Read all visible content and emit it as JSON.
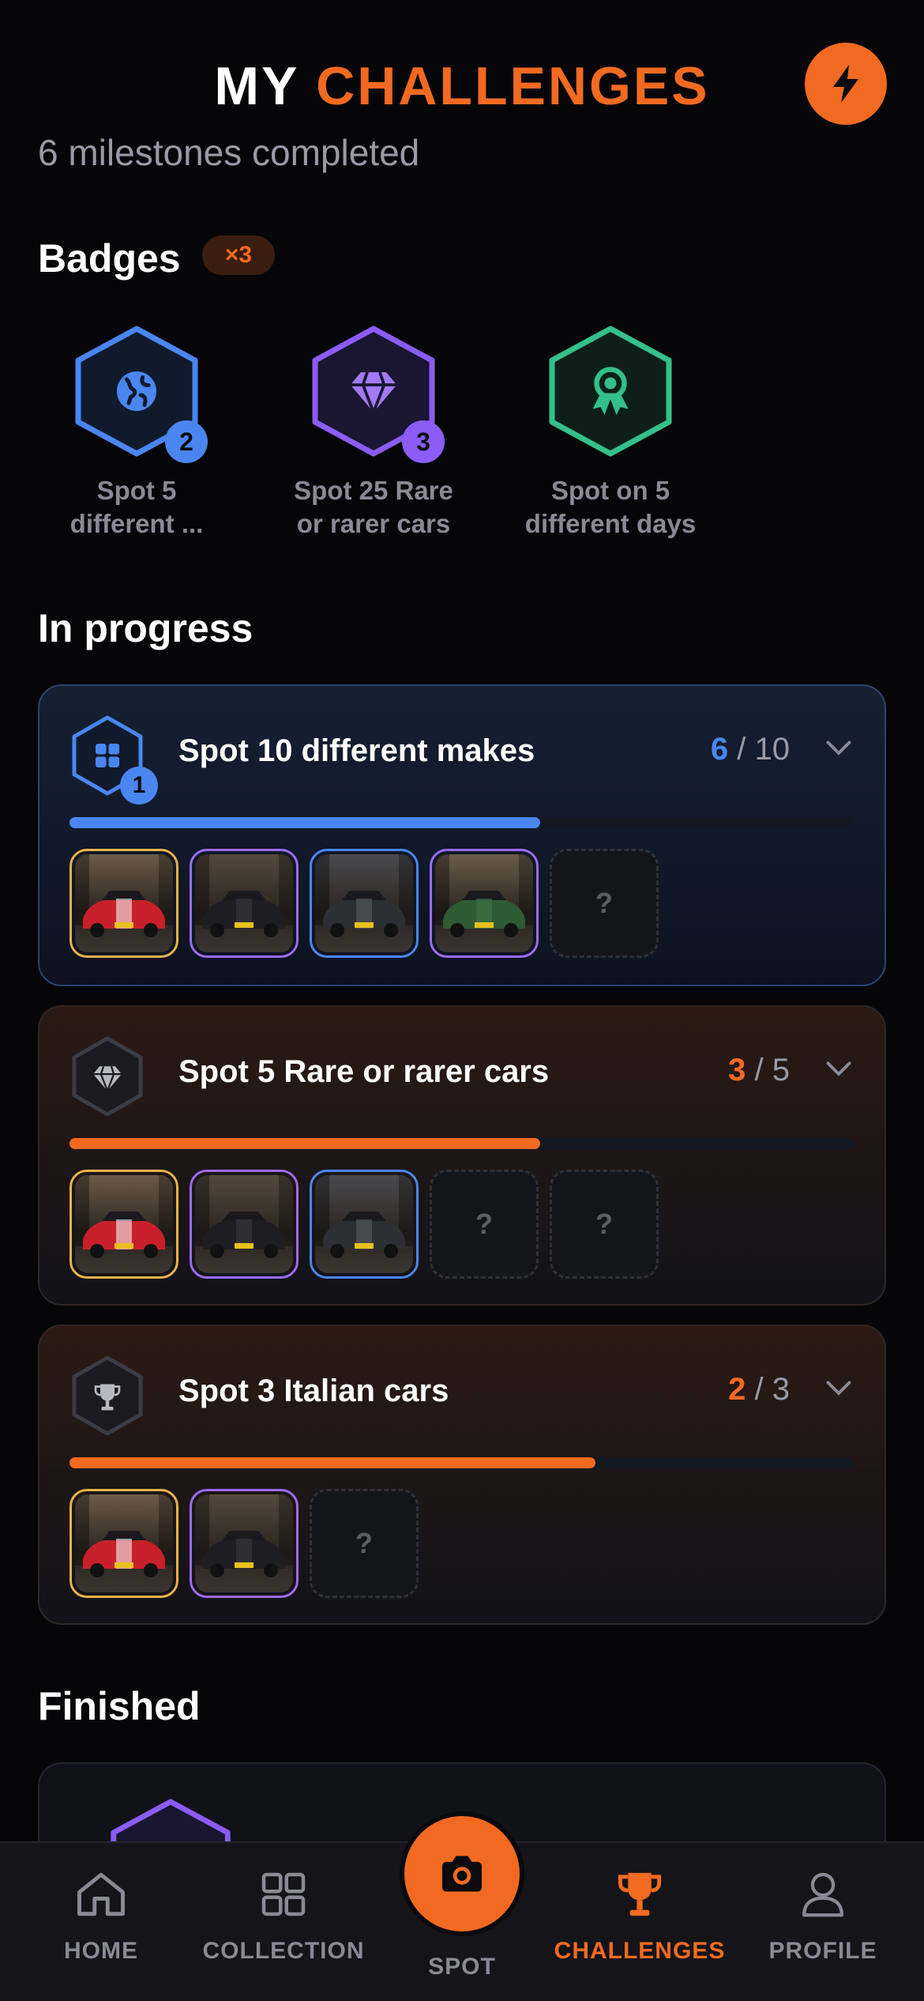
{
  "header": {
    "title_part1": "MY",
    "title_part2": "CHALLENGES",
    "subtitle": "6 milestones completed"
  },
  "badges": {
    "title": "Badges",
    "count": "×3",
    "items": [
      {
        "label_line1": "Spot 5",
        "label_line2": "different ...",
        "level": "2",
        "color": "#4a86f0",
        "icon": "globe-icon"
      },
      {
        "label_line1": "Spot 25 Rare",
        "label_line2": "or rarer cars",
        "level": "3",
        "color": "#8b5cf6",
        "icon": "diamond-icon"
      },
      {
        "label_line1": "Spot on 5",
        "label_line2": "different days",
        "level": "",
        "color": "#34c08a",
        "icon": "award-icon"
      }
    ]
  },
  "in_progress": {
    "title": "In progress",
    "challenges": [
      {
        "title": "Spot 10 different makes",
        "current": "6",
        "total": "/ 10",
        "progress": 0.6,
        "accent": "#4a86f0",
        "icon": "grid-icon",
        "level": "1",
        "thumbs": [
          "gold",
          "purple",
          "blue",
          "purple",
          "empty"
        ]
      },
      {
        "title": "Spot 5 Rare or rarer cars",
        "current": "3",
        "total": "/ 5",
        "progress": 0.6,
        "accent": "#f26a21",
        "icon": "diamond-icon",
        "level": "",
        "thumbs": [
          "gold",
          "purple",
          "blue",
          "empty",
          "empty"
        ]
      },
      {
        "title": "Spot 3 Italian cars",
        "current": "2",
        "total": "/ 3",
        "progress": 0.67,
        "accent": "#f26a21",
        "icon": "trophy-icon",
        "level": "",
        "thumbs": [
          "gold",
          "purple",
          "empty"
        ]
      }
    ]
  },
  "finished": {
    "title": "Finished"
  },
  "empty_slot": "?",
  "nav": {
    "home": "HOME",
    "collection": "COLLECTION",
    "spot": "SPOT",
    "challenges": "CHALLENGES",
    "profile": "PROFILE"
  },
  "colors": {
    "accent": "#f26a21",
    "blue": "#4a86f0",
    "gold": "#e8b24a",
    "purple": "#9b6cf2"
  }
}
